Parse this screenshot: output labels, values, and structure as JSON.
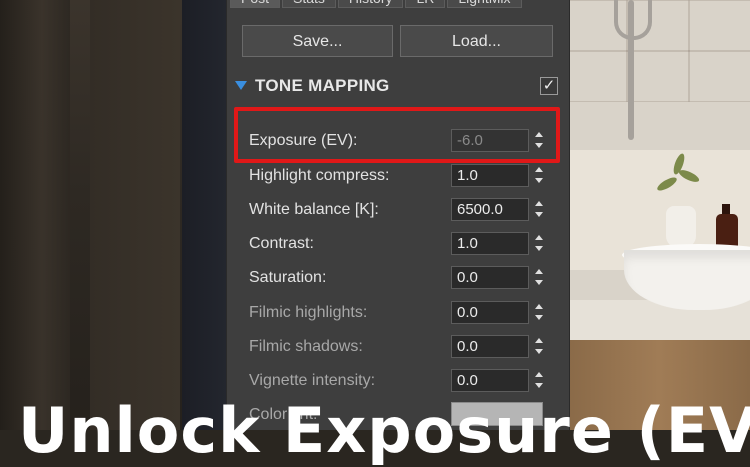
{
  "panel": {
    "tabs": [
      "Post",
      "Stats",
      "History",
      "LR",
      "LightMix"
    ],
    "save_label": "Save...",
    "load_label": "Load...",
    "section_title": "TONE MAPPING",
    "section_enabled_mark": "✓",
    "rows": [
      {
        "label": "Exposure (EV):",
        "value": "-6.0",
        "dim": true
      },
      {
        "label": "Highlight compress:",
        "value": "1.0",
        "dim": false
      },
      {
        "label": "White balance [K]:",
        "value": "6500.0",
        "dim": false
      },
      {
        "label": "Contrast:",
        "value": "1.0",
        "dim": false
      },
      {
        "label": "Saturation:",
        "value": "0.0",
        "dim": false
      },
      {
        "label": "Filmic highlights:",
        "value": "0.0",
        "dim": true
      },
      {
        "label": "Filmic shadows:",
        "value": "0.0",
        "dim": true
      },
      {
        "label": "Vignette intensity:",
        "value": "0.0",
        "dim": true
      }
    ],
    "color_tint_label": "Color tint:",
    "color_tint_swatch": "#b5b5b5"
  },
  "overlay": {
    "headline": "Unlock Exposure (EV)"
  },
  "colors": {
    "panel_bg": "#3e3e3e",
    "highlight_border": "#e01818",
    "section_triangle": "#3a8fe0"
  }
}
